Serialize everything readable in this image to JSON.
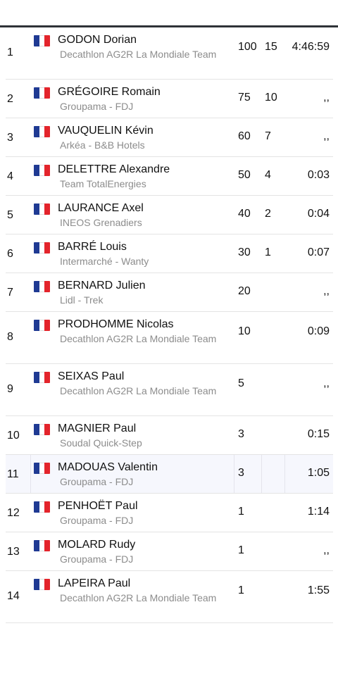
{
  "results": [
    {
      "rank": "1",
      "name": "GODON Dorian",
      "team": "Decathlon AG2R La Mondiale Team",
      "points": "100",
      "bonus": "15",
      "time": "4:46:59"
    },
    {
      "rank": "2",
      "name": "GRÉGOIRE Romain",
      "team": "Groupama - FDJ",
      "points": "75",
      "bonus": "10",
      "time": ",,"
    },
    {
      "rank": "3",
      "name": "VAUQUELIN Kévin",
      "team": "Arkéa - B&B Hotels",
      "points": "60",
      "bonus": "7",
      "time": ",,"
    },
    {
      "rank": "4",
      "name": "DELETTRE Alexandre",
      "team": "Team TotalEnergies",
      "points": "50",
      "bonus": "4",
      "time": "0:03"
    },
    {
      "rank": "5",
      "name": "LAURANCE Axel",
      "team": "INEOS Grenadiers",
      "points": "40",
      "bonus": "2",
      "time": "0:04"
    },
    {
      "rank": "6",
      "name": "BARRÉ Louis",
      "team": "Intermarché - Wanty",
      "points": "30",
      "bonus": "1",
      "time": "0:07"
    },
    {
      "rank": "7",
      "name": "BERNARD Julien",
      "team": "Lidl - Trek",
      "points": "20",
      "bonus": "",
      "time": ",,"
    },
    {
      "rank": "8",
      "name": "PRODHOMME Nicolas",
      "team": "Decathlon AG2R La Mondiale Team",
      "points": "10",
      "bonus": "",
      "time": "0:09"
    },
    {
      "rank": "9",
      "name": "SEIXAS Paul",
      "team": "Decathlon AG2R La Mondiale Team",
      "points": "5",
      "bonus": "",
      "time": ",,"
    },
    {
      "rank": "10",
      "name": "MAGNIER Paul",
      "team": "Soudal Quick-Step",
      "points": "3",
      "bonus": "",
      "time": "0:15"
    },
    {
      "rank": "11",
      "name": "MADOUAS Valentin",
      "team": "Groupama - FDJ",
      "points": "3",
      "bonus": "",
      "time": "1:05"
    },
    {
      "rank": "12",
      "name": "PENHOËT Paul",
      "team": "Groupama - FDJ",
      "points": "1",
      "bonus": "",
      "time": "1:14"
    },
    {
      "rank": "13",
      "name": "MOLARD Rudy",
      "team": "Groupama - FDJ",
      "points": "1",
      "bonus": "",
      "time": ",,"
    },
    {
      "rank": "14",
      "name": "LAPEIRA Paul",
      "team": "Decathlon AG2R La Mondiale Team",
      "points": "1",
      "bonus": "",
      "time": "1:55"
    }
  ],
  "flag_icon": "france-flag-icon",
  "colors": {
    "flag_blue": "#1f3a93",
    "flag_red": "#e3242b",
    "team_text": "#8c8c8c",
    "highlight_row": "#f6f7fd"
  }
}
